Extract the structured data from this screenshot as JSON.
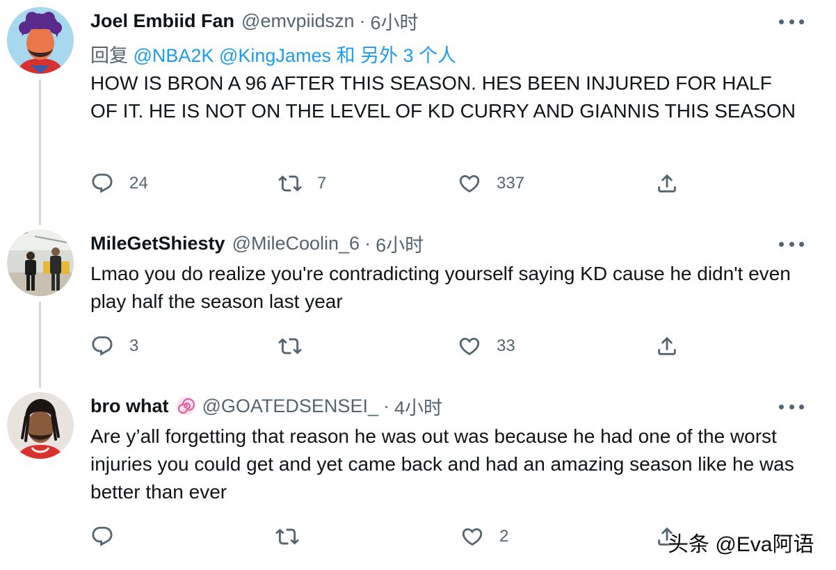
{
  "tweets": [
    {
      "name": "Joel Embiid Fan",
      "handle": "@emvpiidszn",
      "separator": "·",
      "time": "6小时",
      "reply_prefix": "回复",
      "reply_mention_1": "@NBA2K",
      "reply_mention_2": "@KingJames",
      "reply_suffix": "和 另外 3 个人",
      "text": "HOW IS BRON A 96 AFTER THIS SEASON. HES BEEN INJURED FOR HALF OF IT. HE IS NOT ON THE LEVEL OF KD CURRY AND GIANNIS THIS SEASON",
      "replies": "24",
      "retweets": "7",
      "likes": "337",
      "avatar_icon": "cartoon-man-purple-hair-avatar"
    },
    {
      "name": "MileGetShiesty",
      "handle": "@MileCoolin_6",
      "separator": "·",
      "time": "6小时",
      "text": "Lmao you do realize you're contradicting yourself saying KD cause he didn't even play half the season last year",
      "replies": "3",
      "retweets": "",
      "likes": "33",
      "avatar_icon": "basketball-players-photo-avatar"
    },
    {
      "name": "bro what",
      "handle": "@GOATEDSENSEI_",
      "separator": "·",
      "time": "4小时",
      "text": "Are y’all forgetting that reason he was out was because he had one of the worst injuries you could get and yet came back and had an amazing season like he was better than ever",
      "replies": "",
      "retweets": "",
      "likes": "2",
      "avatar_icon": "cartoon-man-dreadlocks-avatar",
      "badge_icon": "swirl-emoji-icon"
    }
  ],
  "watermark": "头条 @Eva阿语",
  "colors": {
    "text": "#0f1419",
    "secondary": "#536471",
    "accent": "#1d9bf0",
    "thread_line": "#cfd9de"
  }
}
